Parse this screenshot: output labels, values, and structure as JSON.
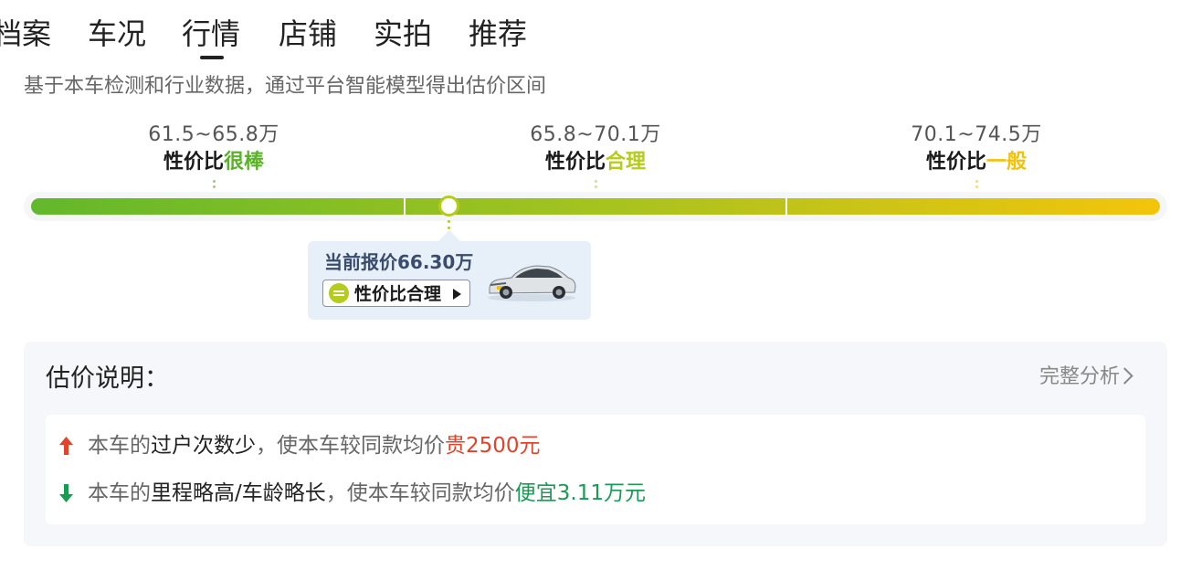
{
  "tabs": [
    {
      "label": "档案"
    },
    {
      "label": "车况"
    },
    {
      "label": "行情"
    },
    {
      "label": "店铺"
    },
    {
      "label": "实拍"
    },
    {
      "label": "推荐"
    }
  ],
  "active_tab": "行情",
  "subtitle": "基于本车检测和行业数据，通过平台智能模型得出估价区间",
  "ranges": [
    {
      "price": "61.5~65.8万",
      "prefix": "性价比",
      "rating": "很棒",
      "color": "#5bb12a"
    },
    {
      "price": "65.8~70.1万",
      "prefix": "性价比",
      "rating": "合理",
      "color": "#b5cc1e"
    },
    {
      "price": "70.1~74.5万",
      "prefix": "性价比",
      "rating": "一般",
      "color": "#f2c10c"
    }
  ],
  "current": {
    "label": "当前报价",
    "price": "66.30万",
    "rating_label": "性价比合理",
    "position_fraction": 0.37
  },
  "explanation": {
    "title": "估价说明：",
    "link_label": "完整分析",
    "items": [
      {
        "direction": "up",
        "prefix": "本车的",
        "factor": "过户次数少",
        "middle": "，使本车较同款均价",
        "result": "贵2500元",
        "color": "#e0442a"
      },
      {
        "direction": "down",
        "prefix": "本车的",
        "factor": "里程略高/车龄略长",
        "middle": "，使本车较同款均价",
        "result": "便宜3.11万元",
        "color": "#1a9a55"
      }
    ]
  }
}
